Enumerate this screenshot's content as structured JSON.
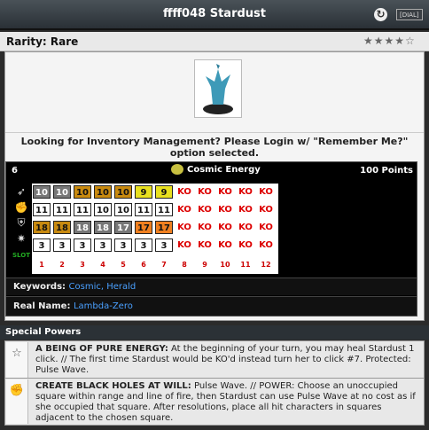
{
  "title": "ffff048 Stardust",
  "dial_button": "[DIAL]",
  "rarity": "Rarity: Rare",
  "stars": "★★★★☆",
  "inventory_message": "Looking for Inventory Management? Please Login w/ \"Remember Me?\" option selected.",
  "dial": {
    "point_marker": "6",
    "keyword_title": "Cosmic Energy",
    "points": "100 Points",
    "rows": [
      [
        "10",
        "10",
        "10",
        "10",
        "10",
        "9",
        "9",
        "KO",
        "KO",
        "KO",
        "KO",
        "KO"
      ],
      [
        "11",
        "11",
        "11",
        "10",
        "10",
        "11",
        "11",
        "KO",
        "KO",
        "KO",
        "KO",
        "KO"
      ],
      [
        "18",
        "18",
        "18",
        "18",
        "17",
        "17",
        "17",
        "KO",
        "KO",
        "KO",
        "KO",
        "KO"
      ],
      [
        "3",
        "3",
        "3",
        "3",
        "3",
        "3",
        "3",
        "KO",
        "KO",
        "KO",
        "KO",
        "KO"
      ]
    ],
    "row_colors": [
      [
        "#777",
        "#777",
        "#c88a10",
        "#c88a10",
        "#c88a10",
        "#e8e020",
        "#e8e020",
        "",
        "",
        "",
        "",
        ""
      ],
      [
        "#fff",
        "#fff",
        "#fff",
        "#fff",
        "#fff",
        "#fff",
        "#fff",
        "",
        "",
        "",
        "",
        ""
      ],
      [
        "#c88a10",
        "#c88a10",
        "#777",
        "#777",
        "#777",
        "#f08020",
        "#f08020",
        "",
        "",
        "",
        "",
        ""
      ],
      [
        "#fff",
        "#fff",
        "#fff",
        "#fff",
        "#fff",
        "#fff",
        "#fff",
        "",
        "",
        "",
        "",
        ""
      ]
    ],
    "slot_label": "SLOT",
    "slots": [
      "1",
      "2",
      "3",
      "4",
      "5",
      "6",
      "7",
      "8",
      "9",
      "10",
      "11",
      "12"
    ]
  },
  "keywords_label": "Keywords:",
  "keywords": "Cosmic, Herald",
  "real_name_label": "Real Name:",
  "real_name": "Lambda-Zero",
  "special_powers_heading": "Special Powers",
  "powers": [
    {
      "icon": "star-icon",
      "name": "A BEING OF PURE ENERGY:",
      "text": " At the beginning of your turn, you may heal Stardust 1 click. // The first time Stardust would be KO'd instead turn her to click #7. Protected: Pulse Wave."
    },
    {
      "icon": "fist-icon",
      "name": "CREATE BLACK HOLES AT WILL:",
      "text": " Pulse Wave. // POWER: Choose an unoccupied square within range and line of fire, then Stardust can use Pulse Wave at no cost as if she occupied that square. After resolutions, place all hit characters in squares adjacent to the chosen square."
    }
  ]
}
